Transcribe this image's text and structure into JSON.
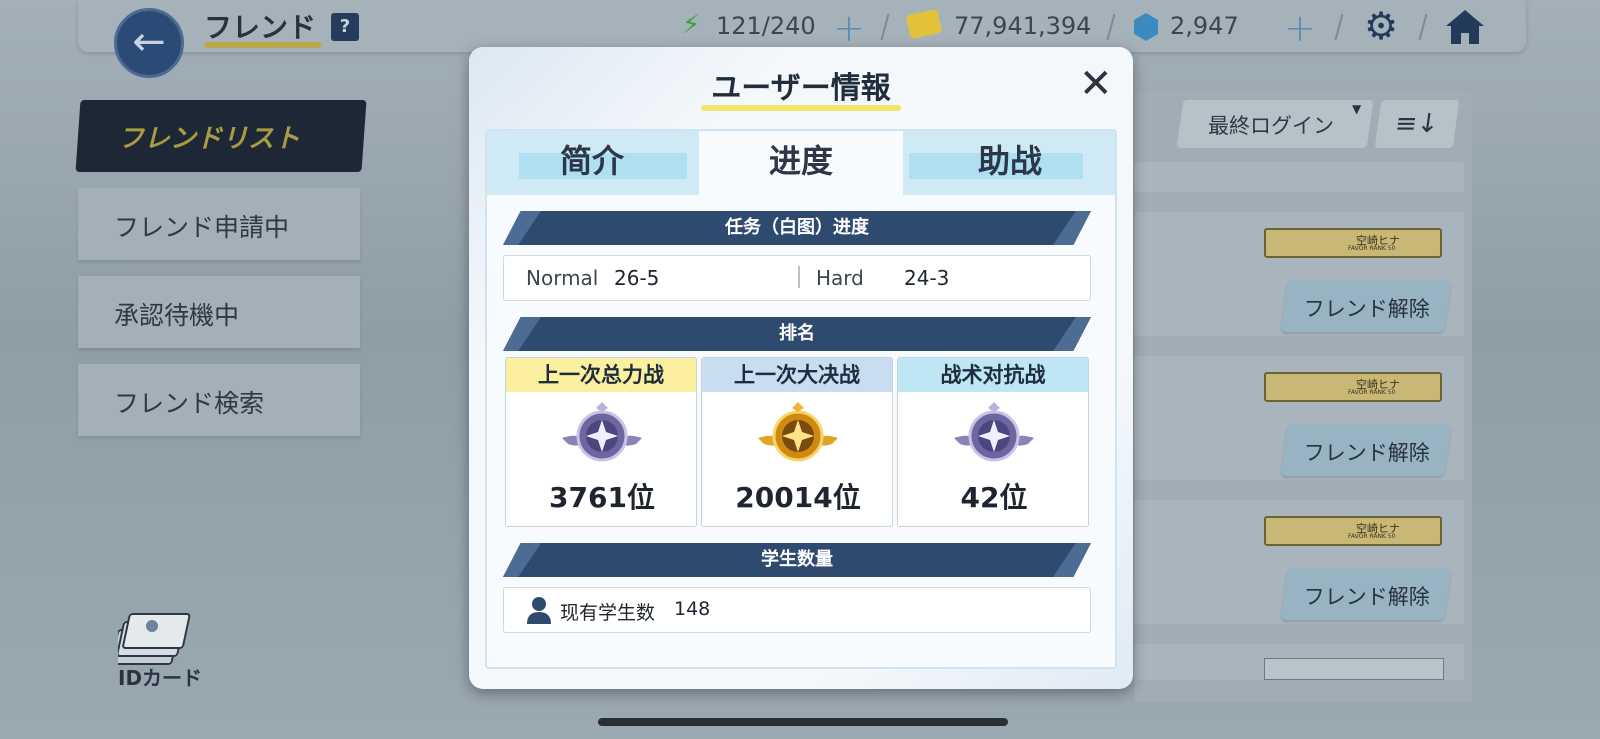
{
  "header": {
    "title": "フレンド",
    "help": "?",
    "ap": "121/240",
    "credits": "77,941,394",
    "gems": "2,947"
  },
  "sidebar": {
    "items": [
      {
        "label": "フレンドリスト",
        "active": true
      },
      {
        "label": "フレンド申請中"
      },
      {
        "label": "承認待機中"
      },
      {
        "label": "フレンド検索"
      }
    ],
    "id_card": "IDカード"
  },
  "list": {
    "sort_label": "最終ログイン",
    "order_icon": "≡↓",
    "rows": [
      {
        "character": "空崎ヒナ",
        "favor": "FAVOR RANK 50",
        "action": "フレンド解除"
      },
      {
        "character": "空崎ヒナ",
        "favor": "FAVOR RANK 50",
        "action": "フレンド解除"
      },
      {
        "character": "空崎ヒナ",
        "favor": "FAVOR RANK 50",
        "action": "フレンド解除"
      }
    ]
  },
  "modal": {
    "title": "ユーザー情報",
    "tabs": [
      {
        "label": "简介"
      },
      {
        "label": "进度",
        "active": true
      },
      {
        "label": "助战"
      }
    ],
    "progress_section": "任务（白图）进度",
    "normal_label": "Normal",
    "normal_value": "26-5",
    "hard_label": "Hard",
    "hard_value": "24-3",
    "ranking_section": "排名",
    "rankings": [
      {
        "label": "上一次总力战",
        "value": "3761位",
        "header_color": "#fbf0a0",
        "emblem": "silver"
      },
      {
        "label": "上一次大决战",
        "value": "20014位",
        "header_color": "#c9ddf1",
        "emblem": "gold"
      },
      {
        "label": "战术对抗战",
        "value": "42位",
        "header_color": "#bfe6f4",
        "emblem": "silver"
      }
    ],
    "students_section": "学生数量",
    "students_label": "现有学生数",
    "students_value": "148"
  },
  "colors": {
    "accent_dark": "#2e4a6f",
    "highlight_yellow": "#f3e46a",
    "emblem_gold": "#e0a526",
    "emblem_silver": "#8a83b8"
  }
}
